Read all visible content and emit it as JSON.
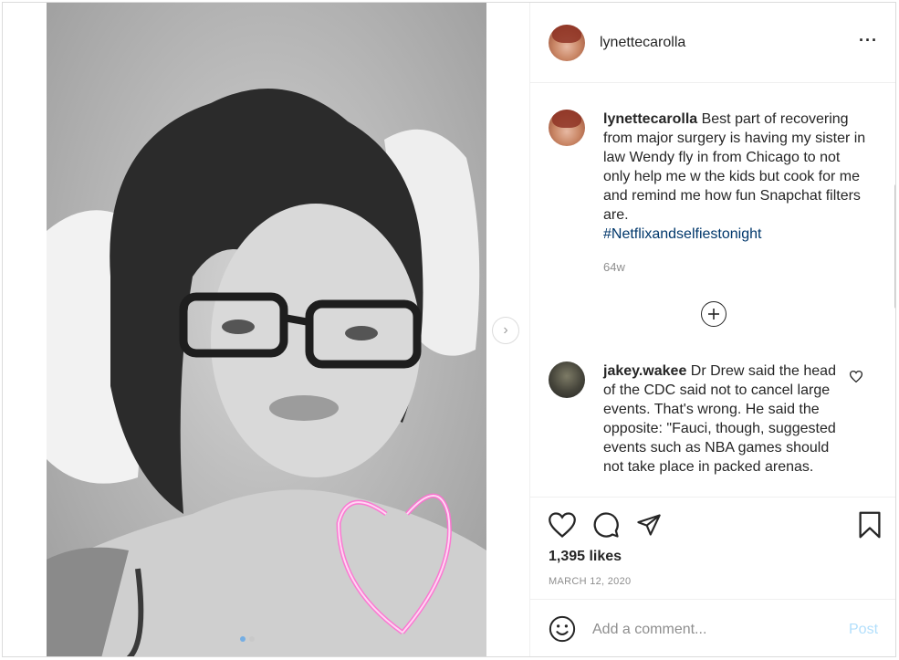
{
  "post": {
    "username": "lynettecarolla",
    "more_icon": "more-horizontal-icon",
    "caption_text": " Best part of recovering from major surgery is having my sister in law Wendy fly in from Chicago to not only help me w the kids but cook for me and remind me how fun Snapchat filters are.",
    "hashtag": "#Netflixandselfiestonight",
    "caption_age": "64w",
    "load_more_icon": "plus-circle-icon",
    "comment": {
      "username": "jakey.wakee",
      "text": " Dr Drew said the head of the CDC said not to cancel large events. That's wrong. He said the opposite: \"Fauci, though, suggested events such as NBA games should not take place in packed arenas."
    },
    "likes": "1,395 likes",
    "date": "MARCH 12, 2020",
    "add_comment_placeholder": "Add a comment...",
    "post_label": "Post"
  },
  "carousel": {
    "total_slides": 2,
    "active_slide": 1
  },
  "icons": [
    "heart-icon",
    "comment-icon",
    "share-icon",
    "bookmark-icon",
    "emoji-icon",
    "chevron-right-icon"
  ],
  "colors": {
    "hashtag": "#00376b",
    "post_button": "#b2dffc",
    "muted_text": "#8e8e8e",
    "border": "#dbdbdb"
  }
}
